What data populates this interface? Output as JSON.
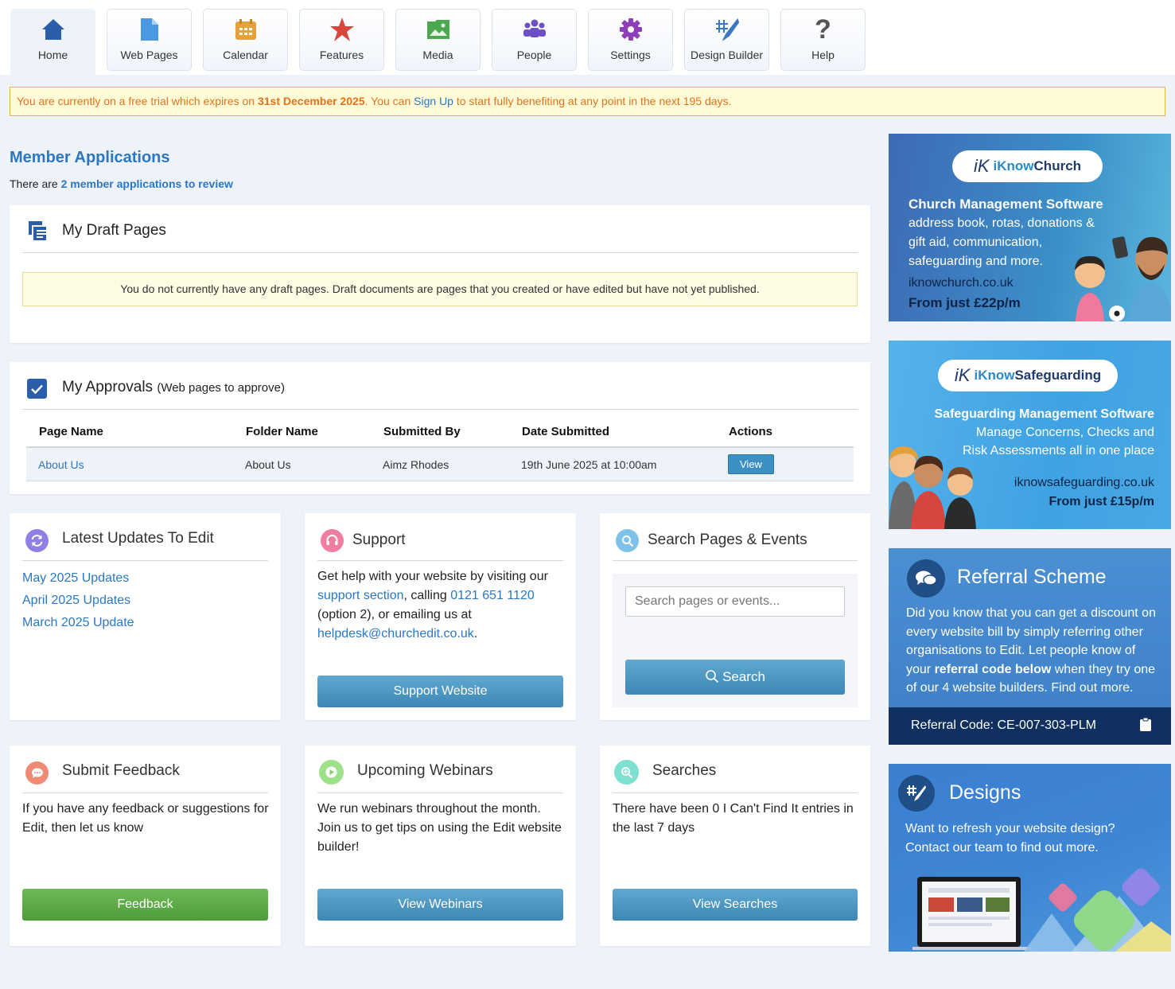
{
  "nav": {
    "tabs": [
      {
        "label": "Home",
        "icon": "home-icon",
        "color": "#2b5ea8"
      },
      {
        "label": "Web Pages",
        "icon": "page-icon",
        "color": "#4a98e0"
      },
      {
        "label": "Calendar",
        "icon": "calendar-icon",
        "color": "#e6a23a"
      },
      {
        "label": "Features",
        "icon": "star-icon",
        "color": "#d9463b"
      },
      {
        "label": "Media",
        "icon": "image-icon",
        "color": "#4aa84f"
      },
      {
        "label": "People",
        "icon": "people-icon",
        "color": "#6c4fc4"
      },
      {
        "label": "Settings",
        "icon": "gear-icon",
        "color": "#8e3fb8"
      },
      {
        "label": "Design Builder",
        "icon": "design-icon",
        "color": "#3b77c2"
      },
      {
        "label": "Help",
        "icon": "question-icon",
        "color": "#555555"
      }
    ]
  },
  "trial": {
    "prefix": "You are currently on a free trial which expires on ",
    "date": "31st December 2025",
    "middle": ". You can ",
    "link": "Sign Up",
    "suffix": " to start fully benefiting at any point in the next 195 days."
  },
  "member_applications": {
    "title": "Member Applications",
    "prefix": "There are ",
    "link": "2 member applications to review"
  },
  "drafts": {
    "title": "My Draft Pages",
    "note": "You do not currently have any draft pages. Draft documents are pages that you created or have edited but have not yet published."
  },
  "approvals": {
    "title": "My Approvals",
    "subtitle": "(Web pages to approve)",
    "columns": [
      "Page Name",
      "Folder Name",
      "Submitted By",
      "Date Submitted",
      "Actions"
    ],
    "rows": [
      {
        "page": "About Us",
        "folder": "About Us",
        "by": "Aimz Rhodes",
        "date": "19th June 2025 at 10:00am",
        "action": "View"
      }
    ]
  },
  "latest": {
    "title": "Latest Updates To Edit",
    "links": [
      "May 2025 Updates",
      "April 2025 Updates",
      "March 2025 Update"
    ]
  },
  "support": {
    "title": "Support",
    "t1": "Get help with your website by visiting our ",
    "l1": "support section",
    "t2": ", calling ",
    "l2": "0121 651 1120",
    "t3": " (option 2), or emailing us at ",
    "l3": "helpdesk@churchedit.co.uk",
    "t4": ".",
    "button": "Support Website"
  },
  "search": {
    "title": "Search Pages & Events",
    "placeholder": "Search pages or events...",
    "button": "Search"
  },
  "feedback": {
    "title": "Submit Feedback",
    "text": "If you have any feedback or suggestions for Edit, then let us know",
    "button": "Feedback"
  },
  "webinars": {
    "title": "Upcoming Webinars",
    "text": "We run webinars throughout the month. Join us to get tips on using the Edit website builder!",
    "button": "View Webinars"
  },
  "searches": {
    "title": "Searches",
    "text": "There have been 0 I Can't Find It entries in the last 7 days",
    "button": "View Searches"
  },
  "promo_church": {
    "logo_pre": "iKnow",
    "logo_post": "Church",
    "heading": "Church Management Software",
    "body": "address book, rotas, donations & gift aid, communication, safeguarding and more.",
    "url": "iknowchurch.co.uk",
    "price": "From just £22p/m"
  },
  "promo_safe": {
    "logo_pre": "iKnow",
    "logo_post": "Safeguarding",
    "heading": "Safeguarding Management Software",
    "body1": "Manage Concerns, Checks and",
    "body2": "Risk Assessments all in one place",
    "url": "iknowsafeguarding.co.uk",
    "price": "From just £15p/m"
  },
  "referral": {
    "title": "Referral Scheme",
    "t1": "Did you know that you can get a discount on every website bill by simply referring other organisations to Edit. Let people know of your ",
    "bold": "referral code below",
    "t2": " when they try one of our 4 website builders. Find out more.",
    "code": "Referral Code: CE-007-303-PLM"
  },
  "designs": {
    "title": "Designs",
    "body": "Want to refresh your website design? Contact our team to find out more."
  }
}
